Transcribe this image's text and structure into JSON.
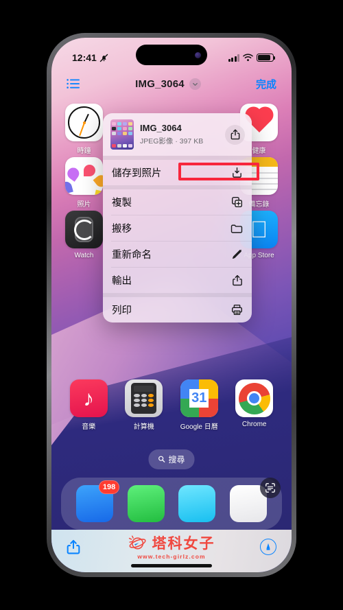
{
  "status_bar": {
    "time": "12:41",
    "silent_icon": "bell-slash-icon",
    "cellular_icon": "cellular-bars-icon",
    "wifi_icon": "wifi-icon",
    "battery_icon": "battery-icon"
  },
  "nav_bar": {
    "list_icon": "list-bullet-icon",
    "title": "IMG_3064",
    "chevron_icon": "chevron-down-icon",
    "done_label": "完成"
  },
  "context_menu": {
    "file_name": "IMG_3064",
    "file_meta": "JPEG影像 · 397 KB",
    "share_icon": "share-icon",
    "items": [
      {
        "label": "儲存到照片",
        "icon": "save-to-photos-icon"
      },
      {
        "label": "複製",
        "icon": "duplicate-icon"
      },
      {
        "label": "搬移",
        "icon": "folder-icon"
      },
      {
        "label": "重新命名",
        "icon": "pencil-icon"
      },
      {
        "label": "輸出",
        "icon": "export-share-icon"
      },
      {
        "label": "列印",
        "icon": "printer-icon"
      }
    ]
  },
  "highlight": {
    "color": "#f8263c",
    "target": "file-meta-text"
  },
  "home_screen": {
    "apps_left": [
      {
        "label": "時鐘",
        "icon": "clock-app-icon"
      },
      {
        "label": "照片",
        "icon": "photos-app-icon"
      },
      {
        "label": "Watch",
        "icon": "watch-app-icon"
      }
    ],
    "apps_right": [
      {
        "label": "健康",
        "icon": "health-app-icon"
      },
      {
        "label": "備忘錄",
        "icon": "notes-app-icon"
      },
      {
        "label": "App Store",
        "icon": "app-store-icon"
      }
    ],
    "apps_bottom": [
      {
        "label": "音樂",
        "icon": "music-app-icon"
      },
      {
        "label": "計算機",
        "icon": "calculator-app-icon"
      },
      {
        "label": "Google 日曆",
        "icon": "google-calendar-icon",
        "day": "31"
      },
      {
        "label": "Chrome",
        "icon": "chrome-app-icon"
      }
    ],
    "search": {
      "label": "搜尋",
      "icon": "search-icon"
    },
    "scan_icon": "live-text-scan-icon",
    "dock": [
      {
        "name": "mail",
        "color": "#2196f3",
        "badge": "198"
      },
      {
        "name": "messages",
        "color": "#32d74b",
        "badge": ""
      },
      {
        "name": "safari",
        "color": "#2ad1f5",
        "badge": ""
      },
      {
        "name": "files",
        "color": "#f4f4f6",
        "badge": ""
      }
    ]
  },
  "bottom_toolbar": {
    "share_icon": "share-icon",
    "markup_icon": "markup-pen-icon"
  },
  "watermark": {
    "logo_icon": "planet-logo-icon",
    "brand": "塔科女子",
    "url": "www.tech-girlz.com",
    "color": "#f0483f"
  }
}
